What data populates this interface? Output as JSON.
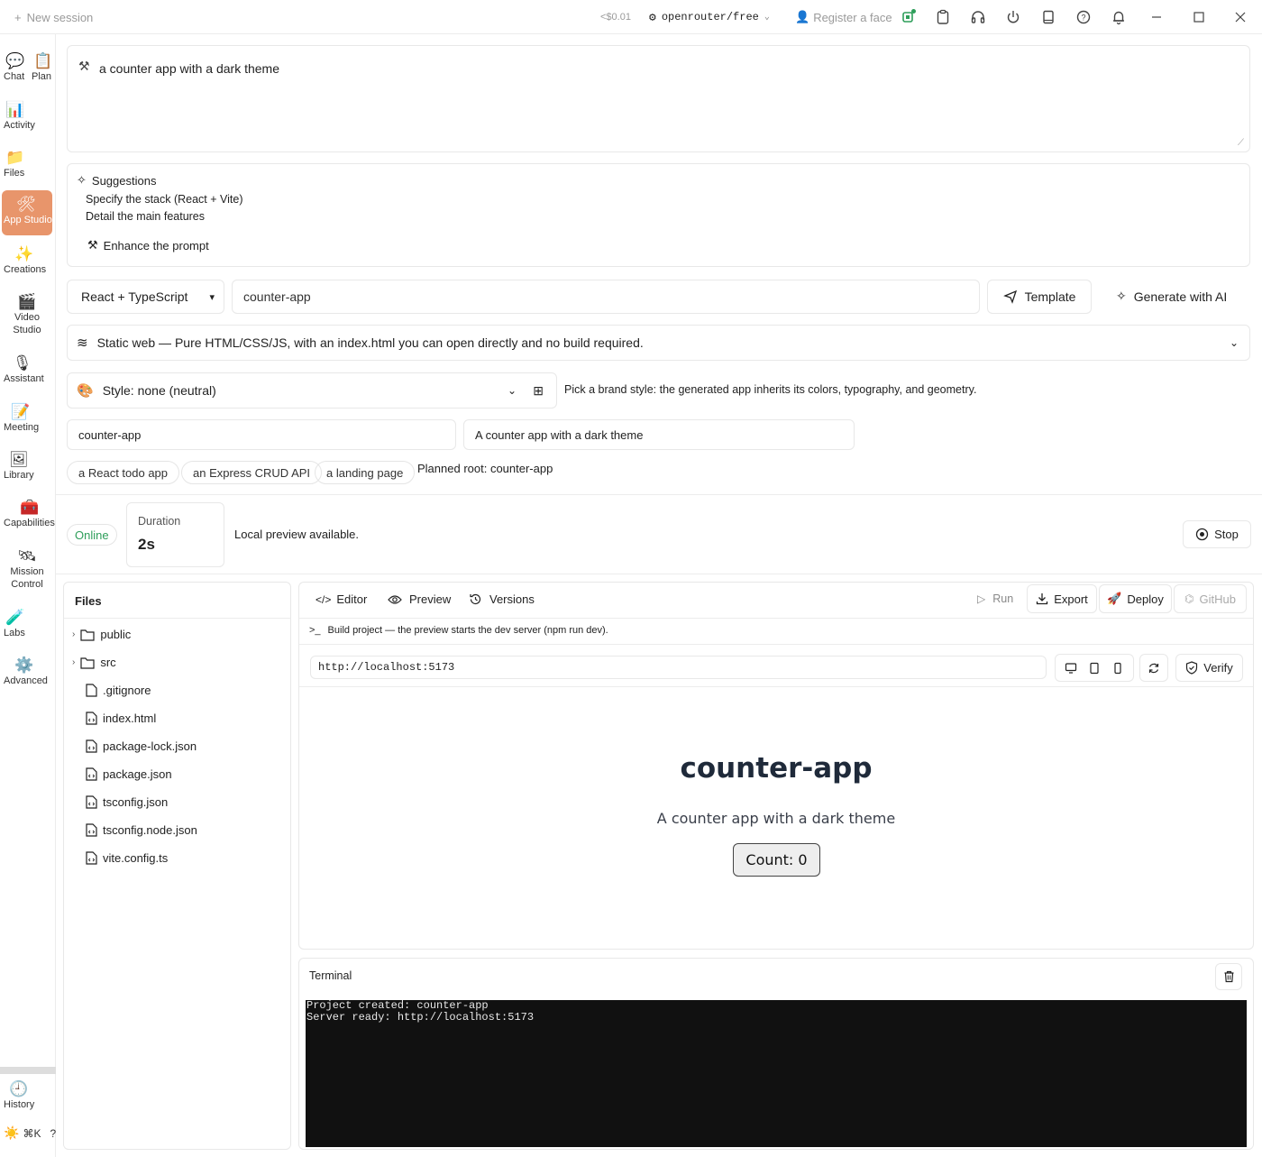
{
  "topbar": {
    "new_session": "New session",
    "cost": "<$0.01",
    "model": "openrouter/free",
    "register_face": "Register a face"
  },
  "sidebar": {
    "items": [
      {
        "label": "Chat",
        "icon": "chat-icon"
      },
      {
        "label": "Plan",
        "icon": "clipboard-icon"
      },
      {
        "label": "Activity",
        "icon": "bar-chart-icon"
      },
      {
        "label": "Files",
        "icon": "folder-icon"
      },
      {
        "label": "App Studio",
        "icon": "tools-icon"
      },
      {
        "label": "Creations",
        "icon": "sparkles-icon"
      },
      {
        "label": "Video Studio",
        "icon": "clapper-icon"
      },
      {
        "label": "Assistant",
        "icon": "microphone-icon"
      },
      {
        "label": "Meeting",
        "icon": "memo-icon"
      },
      {
        "label": "Library",
        "icon": "picture-icon"
      },
      {
        "label": "Capabilities",
        "icon": "toolbox-icon"
      },
      {
        "label": "Mission Control",
        "icon": "satellite-icon"
      },
      {
        "label": "Labs",
        "icon": "test-tube-icon"
      },
      {
        "label": "Advanced",
        "icon": "gear-icon"
      },
      {
        "label": "History",
        "icon": "clock-icon"
      }
    ],
    "shortcut": "⌘K",
    "help": "?"
  },
  "prompt": {
    "text": "a counter app with a dark theme"
  },
  "suggestions": {
    "title": "Suggestions",
    "items": [
      "Specify the stack (React + Vite)",
      "Detail the main features"
    ],
    "enhance": "Enhance the prompt"
  },
  "config": {
    "stack": "React + TypeScript",
    "project_name": "counter-app",
    "template": "Template",
    "generate": "Generate with AI",
    "mode": "Static web — Pure HTML/CSS/JS, with an index.html you can open directly and no build required.",
    "style": "Style: none (neutral)",
    "style_hint": "Pick a brand style: the generated app inherits its colors, typography, and geometry.",
    "name_field": "counter-app",
    "desc_field": "A counter app with a dark theme",
    "examples": [
      "a React todo app",
      "an Express CRUD API",
      "a landing page"
    ],
    "planned_root": "Planned root: counter-app"
  },
  "status": {
    "badge": "Online",
    "duration_label": "Duration",
    "duration_value": "2s",
    "message": "Local preview available.",
    "stop": "Stop"
  },
  "files": {
    "title": "Files",
    "folders": [
      "public",
      "src"
    ],
    "items": [
      ".gitignore",
      "index.html",
      "package-lock.json",
      "package.json",
      "tsconfig.json",
      "tsconfig.node.json",
      "vite.config.ts"
    ]
  },
  "editor": {
    "tabs": [
      "Editor",
      "Preview",
      "Versions"
    ],
    "run": "Run",
    "export": "Export",
    "deploy": "Deploy",
    "github": "GitHub",
    "build_note": "Build project — the preview starts the dev server (npm run dev).",
    "url": "http://localhost:5173",
    "verify": "Verify"
  },
  "preview": {
    "title": "counter-app",
    "subtitle": "A counter app with a dark theme",
    "button": "Count: 0"
  },
  "terminal": {
    "title": "Terminal",
    "lines": [
      "Project created: counter-app",
      "Server ready: http://localhost:5173"
    ]
  },
  "colors": {
    "accent": "#e8956b",
    "online": "#2e9e5a",
    "terminal_bg": "#111111"
  }
}
